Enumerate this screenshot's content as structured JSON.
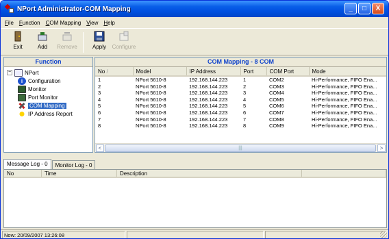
{
  "window": {
    "title": "NPort Administrator-COM Mapping",
    "buttons": {
      "minimize": "_",
      "maximize": "□",
      "close": "X"
    }
  },
  "menu": [
    "File",
    "Function",
    "COM Mapping",
    "View",
    "Help"
  ],
  "toolbar": {
    "exit": "Exit",
    "add": "Add",
    "remove": "Remove",
    "apply": "Apply",
    "configure": "Configure"
  },
  "function_panel": {
    "header": "Function",
    "root": "NPort",
    "items": [
      "Configuration",
      "Monitor",
      "Port Monitor",
      "COM Mapping",
      "IP Address Report"
    ],
    "selected": "COM Mapping"
  },
  "com_mapping": {
    "header": "COM Mapping - 8 COM",
    "columns": [
      "No",
      "Model",
      "IP Address",
      "Port",
      "COM Port",
      "Mode"
    ],
    "rows": [
      [
        "1",
        "NPort 5610-8",
        "192.168.144.223",
        "1",
        "COM2",
        "Hi-Performance, FIFO Ena..."
      ],
      [
        "2",
        "NPort 5610-8",
        "192.168.144.223",
        "2",
        "COM3",
        "Hi-Performance, FIFO Ena..."
      ],
      [
        "3",
        "NPort 5610-8",
        "192.168.144.223",
        "3",
        "COM4",
        "Hi-Performance, FIFO Ena..."
      ],
      [
        "4",
        "NPort 5610-8",
        "192.168.144.223",
        "4",
        "COM5",
        "Hi-Performance, FIFO Ena..."
      ],
      [
        "5",
        "NPort 5610-8",
        "192.168.144.223",
        "5",
        "COM6",
        "Hi-Performance, FIFO Ena..."
      ],
      [
        "6",
        "NPort 5610-8",
        "192.168.144.223",
        "6",
        "COM7",
        "Hi-Performance, FIFO Ena..."
      ],
      [
        "7",
        "NPort 5610-8",
        "192.168.144.223",
        "7",
        "COM8",
        "Hi-Performance, FIFO Ena..."
      ],
      [
        "8",
        "NPort 5610-8",
        "192.168.144.223",
        "8",
        "COM9",
        "Hi-Performance, FIFO Ena..."
      ]
    ]
  },
  "log": {
    "tabs": [
      "Message Log - 0",
      "Monitor Log - 0"
    ],
    "columns": [
      "No",
      "Time",
      "Description"
    ]
  },
  "status": {
    "now": "Now: 20/09/2007 13:26:08"
  }
}
